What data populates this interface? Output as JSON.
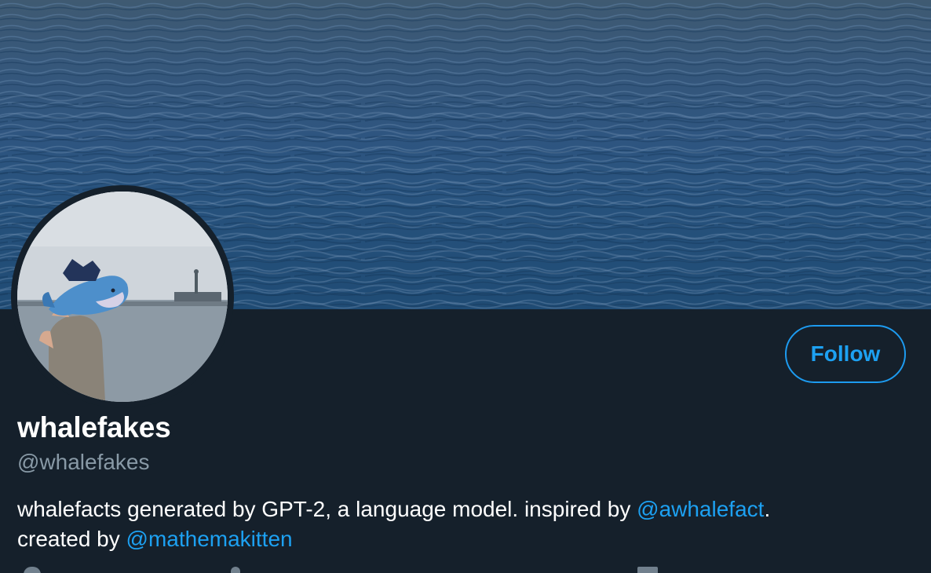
{
  "profile": {
    "display_name": "whalefakes",
    "handle": "@whalefakes",
    "bio": {
      "part1": "whalefacts generated by GPT-2, a language model. inspired by ",
      "mention1": "@awhalefact",
      "part2": ".",
      "part3": "created by ",
      "mention2": "@mathemakitten"
    }
  },
  "actions": {
    "follow_label": "Follow"
  },
  "icons": {
    "location": "location-icon",
    "link": "link-icon",
    "calendar": "calendar-icon"
  },
  "colors": {
    "background": "#15202b",
    "accent": "#1da1f2",
    "secondary_text": "#8899a6",
    "primary_text": "#ffffff"
  }
}
